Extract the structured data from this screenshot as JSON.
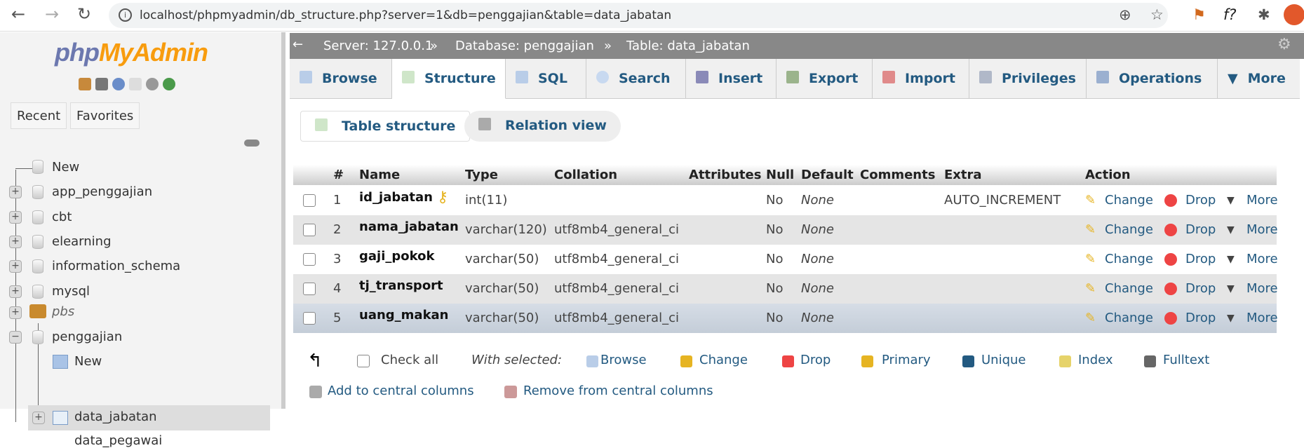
{
  "browser": {
    "url": "localhost/phpmyadmin/db_structure.php?server=1&db=penggajian&table=data_jabatan",
    "icons": [
      "back-icon",
      "forward-icon",
      "reload-icon",
      "info-icon",
      "zoom-icon",
      "star-icon",
      "extension-icon",
      "function-icon",
      "puzzle-icon",
      "profile-icon"
    ]
  },
  "sidebar": {
    "logo": {
      "php": "php",
      "myadmin": "MyAdmin"
    },
    "tabs": [
      "Recent",
      "Favorites"
    ],
    "tree": [
      {
        "label": "New"
      },
      {
        "label": "app_penggajian"
      },
      {
        "label": "cbt"
      },
      {
        "label": "elearning"
      },
      {
        "label": "information_schema"
      },
      {
        "label": "mysql"
      },
      {
        "label": "pbs"
      },
      {
        "label": "penggajian"
      },
      {
        "label": "New"
      },
      {
        "label": "data_jabatan"
      },
      {
        "label": "data_pegawai"
      }
    ]
  },
  "breadcrumb": {
    "server": "Server: 127.0.0.1",
    "sep": "»",
    "database": "Database: penggajian",
    "table": "Table: data_jabatan"
  },
  "tabs": [
    "Browse",
    "Structure",
    "SQL",
    "Search",
    "Insert",
    "Export",
    "Import",
    "Privileges",
    "Operations",
    "More"
  ],
  "active_tab": "Structure",
  "subtabs": [
    "Table structure",
    "Relation view"
  ],
  "table": {
    "headers": [
      "#",
      "Name",
      "Type",
      "Collation",
      "Attributes",
      "Null",
      "Default",
      "Comments",
      "Extra",
      "Action"
    ],
    "rows": [
      {
        "num": "1",
        "name": "id_jabatan",
        "type": "int(11)",
        "collation": "",
        "null": "No",
        "default": "None",
        "extra": "AUTO_INCREMENT",
        "primary": true
      },
      {
        "num": "2",
        "name": "nama_jabatan",
        "type": "varchar(120)",
        "collation": "utf8mb4_general_ci",
        "null": "No",
        "default": "None",
        "extra": ""
      },
      {
        "num": "3",
        "name": "gaji_pokok",
        "type": "varchar(50)",
        "collation": "utf8mb4_general_ci",
        "null": "No",
        "default": "None",
        "extra": ""
      },
      {
        "num": "4",
        "name": "tj_transport",
        "type": "varchar(50)",
        "collation": "utf8mb4_general_ci",
        "null": "No",
        "default": "None",
        "extra": ""
      },
      {
        "num": "5",
        "name": "uang_makan",
        "type": "varchar(50)",
        "collation": "utf8mb4_general_ci",
        "null": "No",
        "default": "None",
        "extra": ""
      }
    ],
    "actions": {
      "change": "Change",
      "drop": "Drop",
      "more": "More"
    }
  },
  "bulk": {
    "check_all": "Check all",
    "with_selected": "With selected:",
    "buttons": [
      "Browse",
      "Change",
      "Drop",
      "Primary",
      "Unique",
      "Index",
      "Fulltext"
    ],
    "add_central": "Add to central columns",
    "remove_central": "Remove from central columns"
  }
}
